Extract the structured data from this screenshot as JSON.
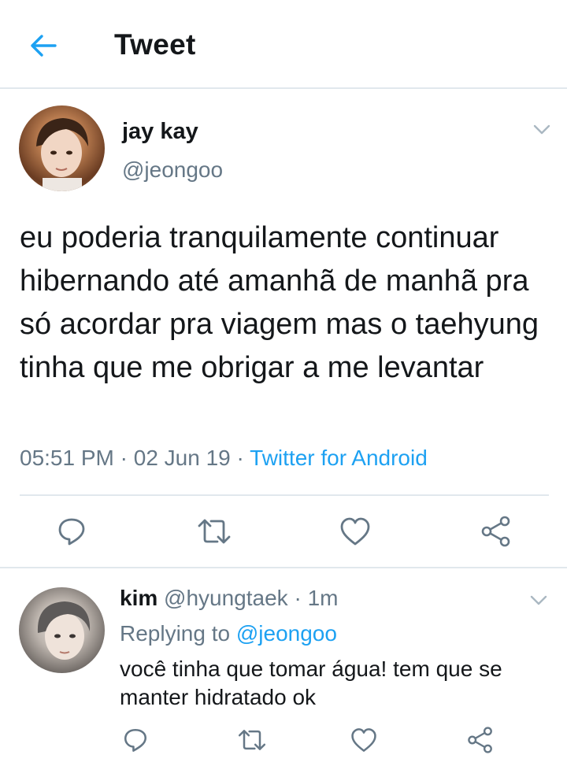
{
  "header": {
    "title": "Tweet",
    "back_icon": "arrow-left-icon"
  },
  "colors": {
    "accent": "#1da1f2",
    "secondary_text": "#657786",
    "primary_text": "#14171a",
    "divider": "#e1e8ed"
  },
  "tweet": {
    "author_name": "jay kay",
    "author_handle": "@jeongoo",
    "text": "eu poderia tranquilamente continuar hibernando até amanhã de manhã pra só acordar pra viagem mas o taehyung tinha que me obrigar a me levantar",
    "time": "05:51 PM",
    "date": "02 Jun 19",
    "source": "Twitter for Android",
    "separator": " · ",
    "actions": [
      "reply-icon",
      "retweet-icon",
      "like-icon",
      "share-icon"
    ]
  },
  "reply": {
    "author_name": "kim",
    "author_handle": "@hyungtaek",
    "separator": " · ",
    "age": "1m",
    "replying_prefix": "Replying to",
    "replying_to": "@jeongoo",
    "text": "você tinha que tomar água! tem que se manter hidratado ok",
    "actions": [
      "reply-icon",
      "retweet-icon",
      "like-icon",
      "share-icon"
    ]
  }
}
